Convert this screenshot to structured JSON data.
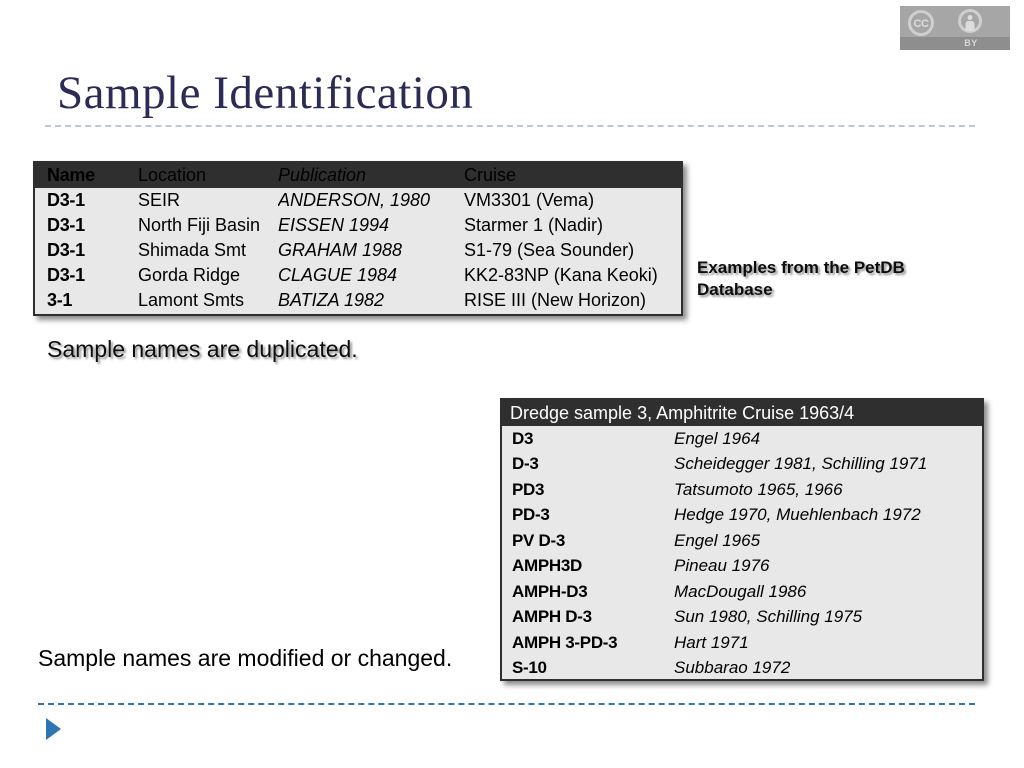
{
  "badge": {
    "name": "creative-commons-by",
    "cc_label": "CC",
    "by_label": "BY"
  },
  "slide": {
    "title": "Sample Identification"
  },
  "notes": {
    "petdb": "Examples from the PetDB Database",
    "duplicated": "Sample names are duplicated.",
    "modified": "Sample names are modified or changed."
  },
  "table_duplicates": {
    "headers": [
      "Name",
      "Location",
      "Publication",
      "Cruise"
    ],
    "rows": [
      {
        "name": "D3-1",
        "location": "SEIR",
        "publication": "ANDERSON, 1980",
        "cruise": "VM3301 (Vema)"
      },
      {
        "name": "D3-1",
        "location": "North Fiji Basin",
        "publication": "EISSEN 1994",
        "cruise": "Starmer 1 (Nadir)"
      },
      {
        "name": "D3-1",
        "location": "Shimada Smt",
        "publication": "GRAHAM 1988",
        "cruise": "S1-79 (Sea Sounder)"
      },
      {
        "name": "D3-1",
        "location": "Gorda Ridge",
        "publication": "CLAGUE 1984",
        "cruise": "KK2-83NP (Kana Keoki)"
      },
      {
        "name": "3-1",
        "location": "Lamont Smts",
        "publication": "BATIZA 1982",
        "cruise": "RISE III (New Horizon)"
      }
    ]
  },
  "table_modified": {
    "header": "Dredge sample 3, Amphitrite Cruise 1963/4",
    "rows": [
      {
        "name": "D3",
        "reference": "Engel 1964"
      },
      {
        "name": "D-3",
        "reference": "Scheidegger 1981, Schilling 1971"
      },
      {
        "name": "PD3",
        "reference": "Tatsumoto 1965, 1966"
      },
      {
        "name": "PD-3",
        "reference": "Hedge 1970, Muehlenbach 1972"
      },
      {
        "name": "PV D-3",
        "reference": "Engel 1965"
      },
      {
        "name": "AMPH3D",
        "reference": "Pineau 1976"
      },
      {
        "name": "AMPH-D3",
        "reference": "MacDougall 1986"
      },
      {
        "name": "AMPH D-3",
        "reference": "Sun 1980, Schilling 1975"
      },
      {
        "name": "AMPH 3-PD-3",
        "reference": "Hart 1971"
      },
      {
        "name": "S-10",
        "reference": "Subbarao 1972"
      }
    ]
  },
  "colors": {
    "title": "#2b2b55",
    "title_rule": "#b9c8db",
    "footer_rule": "#2e75b6",
    "table_header_bg": "#2f2f2f",
    "table_body_bg": "#e8e8e8"
  }
}
